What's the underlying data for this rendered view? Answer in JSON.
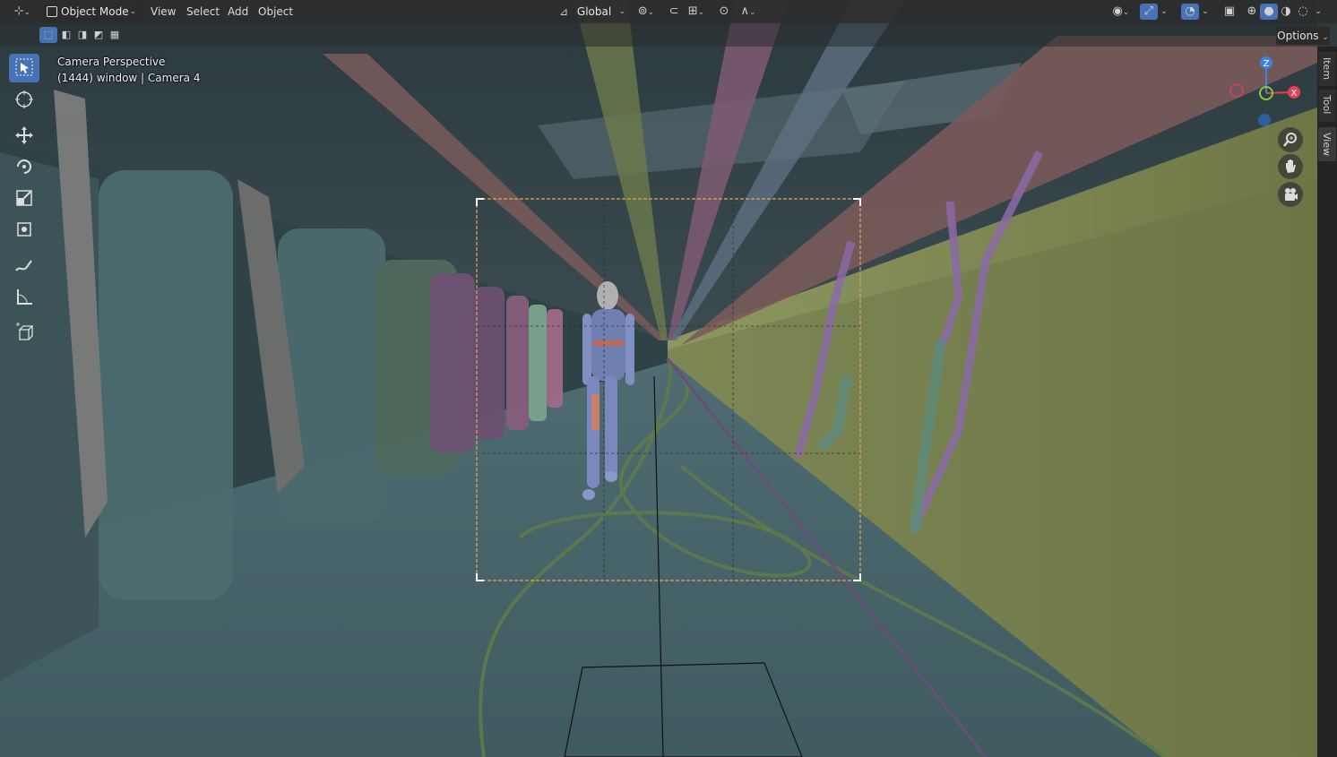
{
  "header": {
    "mode_label": "Object Mode",
    "menus": [
      "View",
      "Select",
      "Add",
      "Object"
    ],
    "transform_orientation": "Global"
  },
  "viewport": {
    "overlay_title": "Camera Perspective",
    "overlay_subtitle": "(1444) window | Camera 4",
    "options_label": "Options"
  },
  "gizmo": {
    "z_label": "Z",
    "x_label": "X",
    "x_color": "#e0425a",
    "y_color": "#8cc63f",
    "z_color": "#3d84e0"
  },
  "sidebar_tabs": [
    "Item",
    "Tool",
    "View"
  ],
  "toolbar": {
    "tools": [
      "select-box-icon",
      "cursor-icon",
      "move-icon",
      "rotate-icon",
      "scale-icon",
      "transform-icon",
      "annotate-icon",
      "measure-icon",
      "add-cube-icon"
    ],
    "active": "select-box-icon"
  },
  "colors": {
    "accent": "#4772b3",
    "camera_frame": "#e8a25a"
  }
}
